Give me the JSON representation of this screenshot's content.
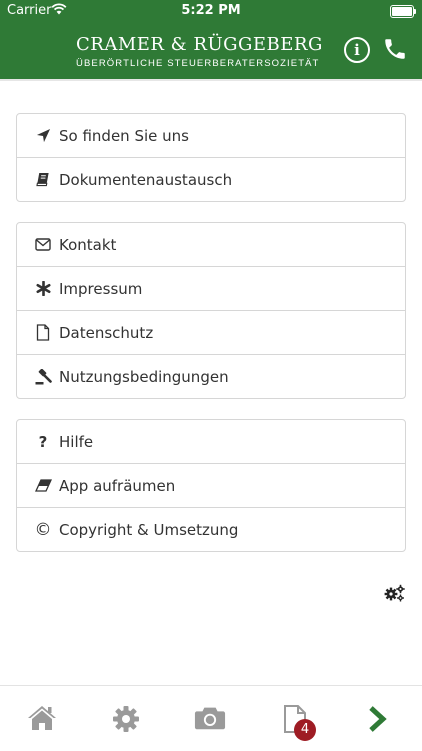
{
  "status_bar": {
    "carrier": "Carrier",
    "time": "5:22 PM"
  },
  "header": {
    "title": "CRAMER & RÜGGEBERG",
    "subtitle": "ÜBERÖRTLICHE STEUERBERATERSOZIETÄT",
    "info_icon": "info-icon",
    "phone_icon": "phone-icon",
    "info_glyph": "i"
  },
  "groups": [
    {
      "items": [
        {
          "label": "So finden Sie uns",
          "icon": "location-arrow-icon"
        },
        {
          "label": "Dokumentenaustausch",
          "icon": "book-icon"
        }
      ]
    },
    {
      "items": [
        {
          "label": "Kontakt",
          "icon": "envelope-icon"
        },
        {
          "label": "Impressum",
          "icon": "asterisk-icon"
        },
        {
          "label": "Datenschutz",
          "icon": "document-icon"
        },
        {
          "label": "Nutzungsbedingungen",
          "icon": "gavel-icon"
        }
      ]
    },
    {
      "items": [
        {
          "label": "Hilfe",
          "icon": "question-icon",
          "glyph": "?"
        },
        {
          "label": "App aufräumen",
          "icon": "eraser-icon"
        },
        {
          "label": "Copyright & Umsetzung",
          "icon": "copyright-icon",
          "glyph": "©"
        }
      ]
    }
  ],
  "settings_cogs_icon": "cogs-icon",
  "tabbar": {
    "tabs": [
      "home-icon",
      "settings-icon",
      "camera-icon",
      "documents-icon",
      "next-arrow-icon"
    ],
    "documents_badge": "4"
  },
  "colors": {
    "brand_green": "#2f7a36",
    "badge_red": "#9e1c24",
    "icon_grey": "#9a9a9a"
  }
}
